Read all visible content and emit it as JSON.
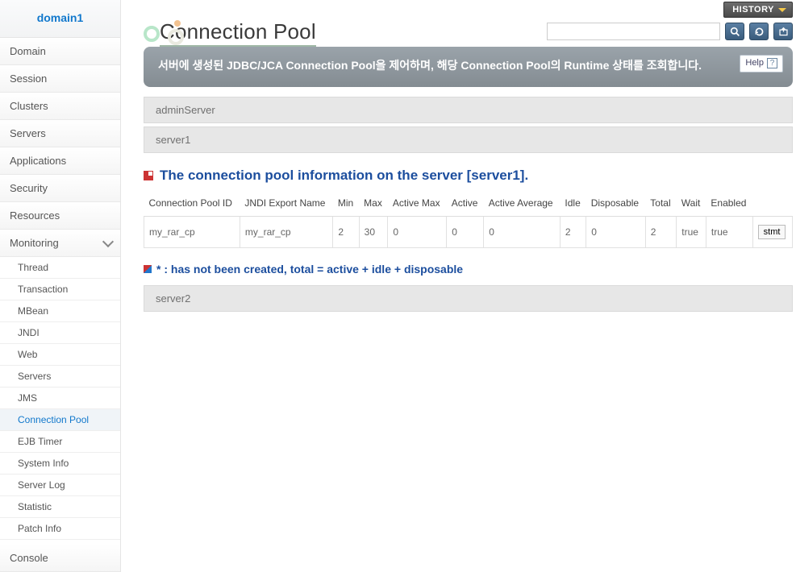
{
  "sidebar": {
    "domain": "domain1",
    "items": [
      {
        "label": "Domain"
      },
      {
        "label": "Session"
      },
      {
        "label": "Clusters"
      },
      {
        "label": "Servers"
      },
      {
        "label": "Applications"
      },
      {
        "label": "Security"
      },
      {
        "label": "Resources"
      },
      {
        "label": "Monitoring"
      }
    ],
    "subitems": [
      {
        "label": "Thread"
      },
      {
        "label": "Transaction"
      },
      {
        "label": "MBean"
      },
      {
        "label": "JNDI"
      },
      {
        "label": "Web"
      },
      {
        "label": "Servers"
      },
      {
        "label": "JMS"
      },
      {
        "label": "Connection Pool"
      },
      {
        "label": "EJB Timer"
      },
      {
        "label": "System Info"
      },
      {
        "label": "Server Log"
      },
      {
        "label": "Statistic"
      },
      {
        "label": "Patch Info"
      }
    ],
    "console": "Console"
  },
  "topbar": {
    "history": "HISTORY"
  },
  "page": {
    "title": "Connection Pool",
    "search_placeholder": "",
    "description": "서버에 생성된 JDBC/JCA Connection Pool을 제어하며, 해당 Connection Pool의 Runtime 상태를 조회합니다.",
    "help": "Help"
  },
  "servers": {
    "admin": "adminServer",
    "s1": "server1",
    "s2": "server2"
  },
  "section": {
    "title": "The connection pool information on the server [server1]."
  },
  "table": {
    "headers": {
      "id": "Connection Pool ID",
      "jndi": "JNDI Export Name",
      "min": "Min",
      "max": "Max",
      "amax": "Active Max",
      "active": "Active",
      "aavg": "Active Average",
      "idle": "Idle",
      "disposable": "Disposable",
      "total": "Total",
      "wait": "Wait",
      "enabled": "Enabled"
    },
    "row": {
      "id": "my_rar_cp",
      "jndi": "my_rar_cp",
      "min": "2",
      "max": "30",
      "amax": "0",
      "active": "0",
      "aavg": "0",
      "idle": "2",
      "disposable": "0",
      "total": "2",
      "wait": "true",
      "enabled": "true",
      "stmt": "stmt"
    }
  },
  "note": "* : has not been created, total = active + idle + disposable"
}
